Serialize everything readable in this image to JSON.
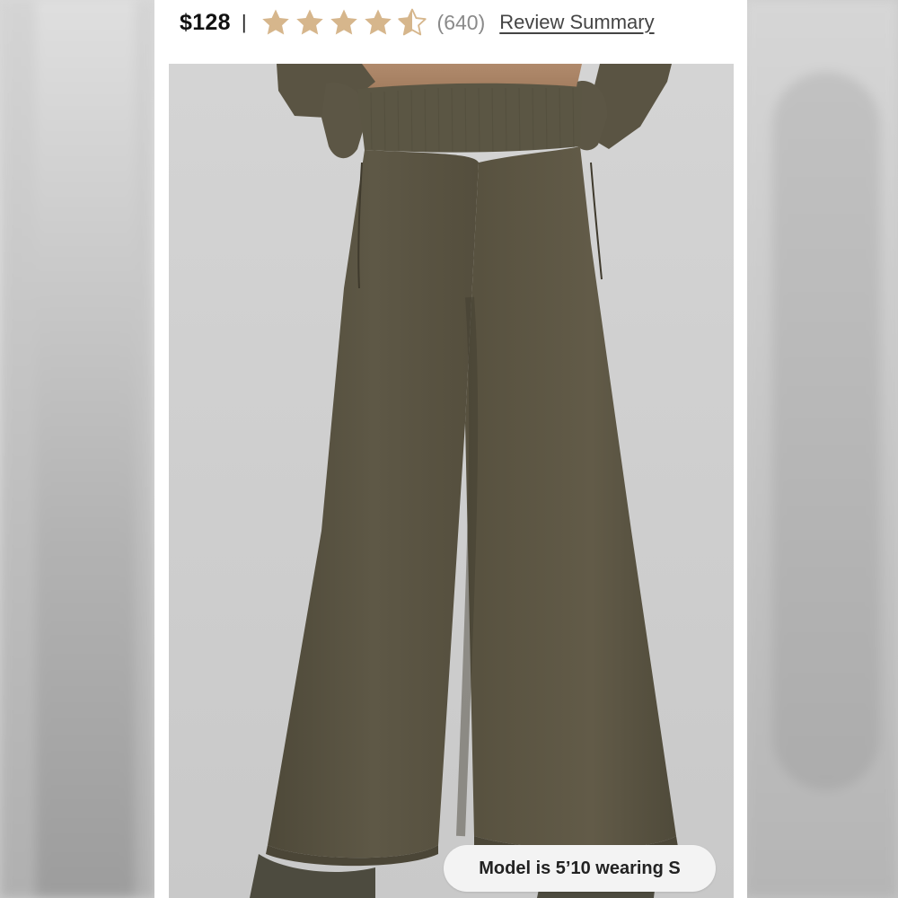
{
  "product": {
    "price": "$128",
    "separator": "|",
    "rating": {
      "value": 4.5,
      "max": 5,
      "count_text": "(640)",
      "star_color": "#d2b48c"
    },
    "review_link": "Review Summary"
  },
  "image": {
    "subject": "olive wide-leg sweatpants",
    "color": "#5a5443"
  },
  "model_badge": "Model is 5’10 wearing S"
}
